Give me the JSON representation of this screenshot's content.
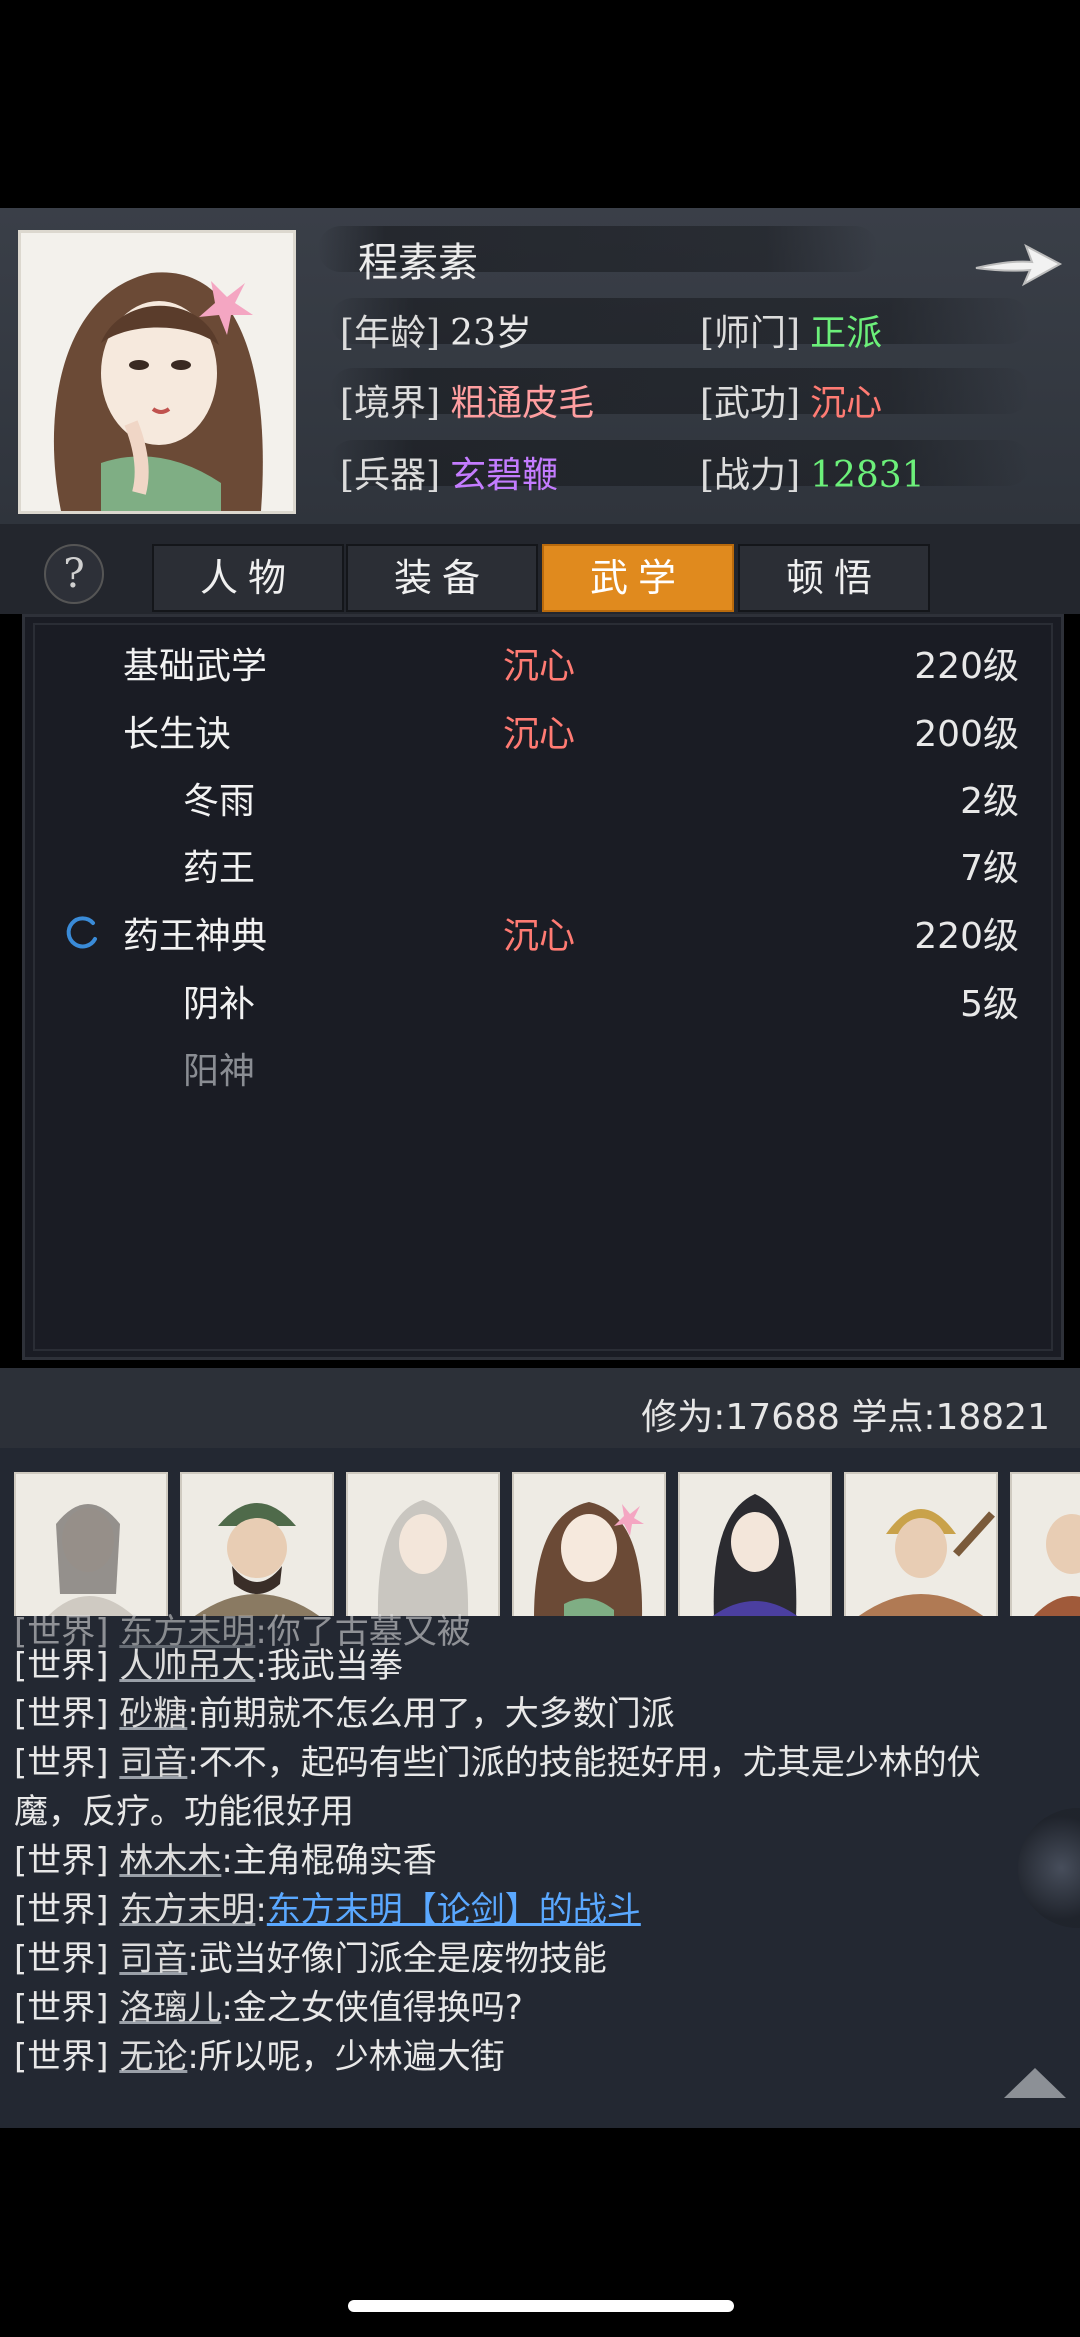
{
  "character": {
    "name": "程素素",
    "info": [
      {
        "label": "[年龄]",
        "value": "23岁",
        "color": "#e8e8e8"
      },
      {
        "label": "[师门]",
        "value": "正派",
        "color": "#6cf07a"
      },
      {
        "label": "[境界]",
        "value": "粗通皮毛",
        "color": "#ff9ea0"
      },
      {
        "label": "[武功]",
        "value": "沉心",
        "color": "#ff7b73"
      },
      {
        "label": "[兵器]",
        "value": "玄碧鞭",
        "color": "#c47cff"
      },
      {
        "label": "[战力]",
        "value": "12831",
        "color": "#6cf07a"
      }
    ]
  },
  "tabs": [
    {
      "label": "人物",
      "active": false
    },
    {
      "label": "装备",
      "active": false
    },
    {
      "label": "武学",
      "active": true
    },
    {
      "label": "顿悟",
      "active": false
    }
  ],
  "help_label": "?",
  "skills": [
    {
      "name": "基础武学",
      "tag": "沉心",
      "level": "220级",
      "indent": false,
      "dim": false,
      "loading": false
    },
    {
      "name": "长生诀",
      "tag": "沉心",
      "level": "200级",
      "indent": false,
      "dim": false,
      "loading": false
    },
    {
      "name": "冬雨",
      "tag": "",
      "level": "2级",
      "indent": true,
      "dim": false,
      "loading": false
    },
    {
      "name": "药王",
      "tag": "",
      "level": "7级",
      "indent": true,
      "dim": false,
      "loading": false
    },
    {
      "name": "药王神典",
      "tag": "沉心",
      "level": "220级",
      "indent": false,
      "dim": false,
      "loading": true
    },
    {
      "name": "阴补",
      "tag": "",
      "level": "5级",
      "indent": true,
      "dim": false,
      "loading": false
    },
    {
      "name": "阳神",
      "tag": "",
      "level": "",
      "indent": true,
      "dim": true,
      "loading": false
    }
  ],
  "stats": {
    "text": "修为:17688 学点:18821"
  },
  "chat": {
    "channel": "[世界]",
    "messages": [
      {
        "who": "东方末明",
        "text": ":你了古墓又被"
      },
      {
        "who": "人帅吊大",
        "text": ":我武当拳"
      },
      {
        "who": "砂糖",
        "text": ":前期就不怎么用了，大多数门派"
      },
      {
        "who": "司音",
        "text": ":不不，起码有些门派的技能挺好用，尤其是少林的伏"
      },
      {
        "who": "",
        "text": "魔，反疗。功能很好用"
      },
      {
        "who": "林木木",
        "text": ":主角棍确实香"
      },
      {
        "who": "东方末明",
        "text": ":",
        "link": "东方末明【论剑】的战斗"
      },
      {
        "who": "司音",
        "text": ":武当好像门派全是废物技能"
      },
      {
        "who": "洛璃儿",
        "text": ":金之女侠值得换吗?"
      },
      {
        "who": "无论",
        "text": ":所以呢，少林遍大街"
      }
    ]
  },
  "avatars": [
    "swordsman-avatar",
    "helmet-warrior-avatar",
    "white-hair-avatar",
    "girl-flower-avatar",
    "scholar-avatar",
    "monk-avatar",
    "partial-avatar"
  ]
}
